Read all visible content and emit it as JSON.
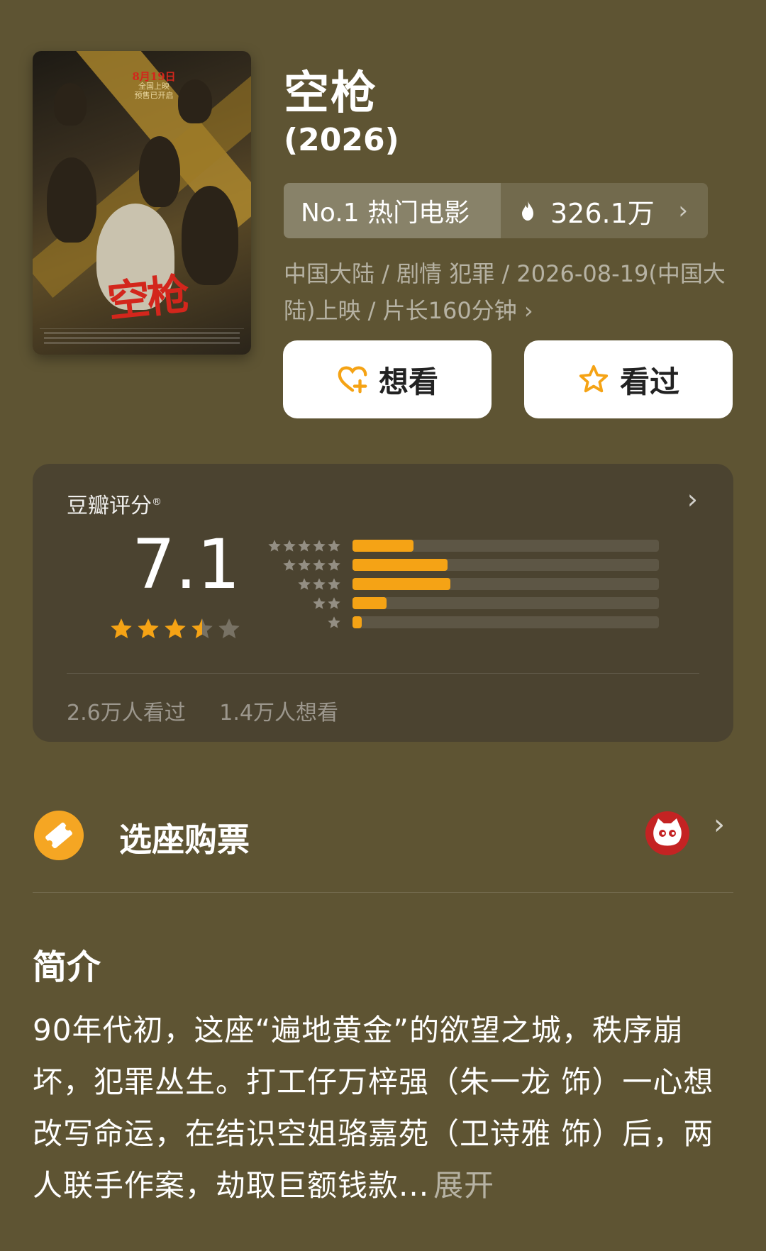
{
  "movie": {
    "title": "空枪",
    "year": "(2026)",
    "rank_label": "No.1 热门电影",
    "heat": "326.1万",
    "meta": "中国大陆 / 剧情 犯罪 / 2026-08-19(中国大陆)上映 / 片长160分钟 ›"
  },
  "poster": {
    "release_line1": "8月19日",
    "release_line2": "全国上映",
    "release_line3": "预售已开启",
    "title_art": "空枪"
  },
  "actions": {
    "want_label": "想看",
    "seen_label": "看过"
  },
  "rating": {
    "label": "豆瓣评分",
    "mark": "®",
    "score": "7.1",
    "stars": 3.5,
    "distribution": [
      {
        "stars": 5,
        "percent": 20
      },
      {
        "stars": 4,
        "percent": 31
      },
      {
        "stars": 3,
        "percent": 32
      },
      {
        "stars": 2,
        "percent": 11
      },
      {
        "stars": 1,
        "percent": 3
      }
    ],
    "seen_count": "2.6万人看过",
    "want_count": "1.4万人想看"
  },
  "ticket": {
    "label": "选座购票"
  },
  "intro": {
    "title": "简介",
    "text": "90年代初，这座“遍地黄金”的欲望之城，秩序崩坏，犯罪丛生。打工仔万梓强（朱一龙 饰）一心想改写命运，在结识空姐骆嘉苑（卫诗雅 饰）后，两人联手作案，劫取巨额钱款...",
    "expand": "展开"
  },
  "colors": {
    "background": "#5e5433",
    "accent": "#f5a315",
    "card": "#4b4330"
  },
  "icons": [
    "heart-plus-icon",
    "star-outline-icon",
    "flame-icon",
    "chevron-right-icon",
    "ticket-icon",
    "maoyan-cat-icon"
  ]
}
